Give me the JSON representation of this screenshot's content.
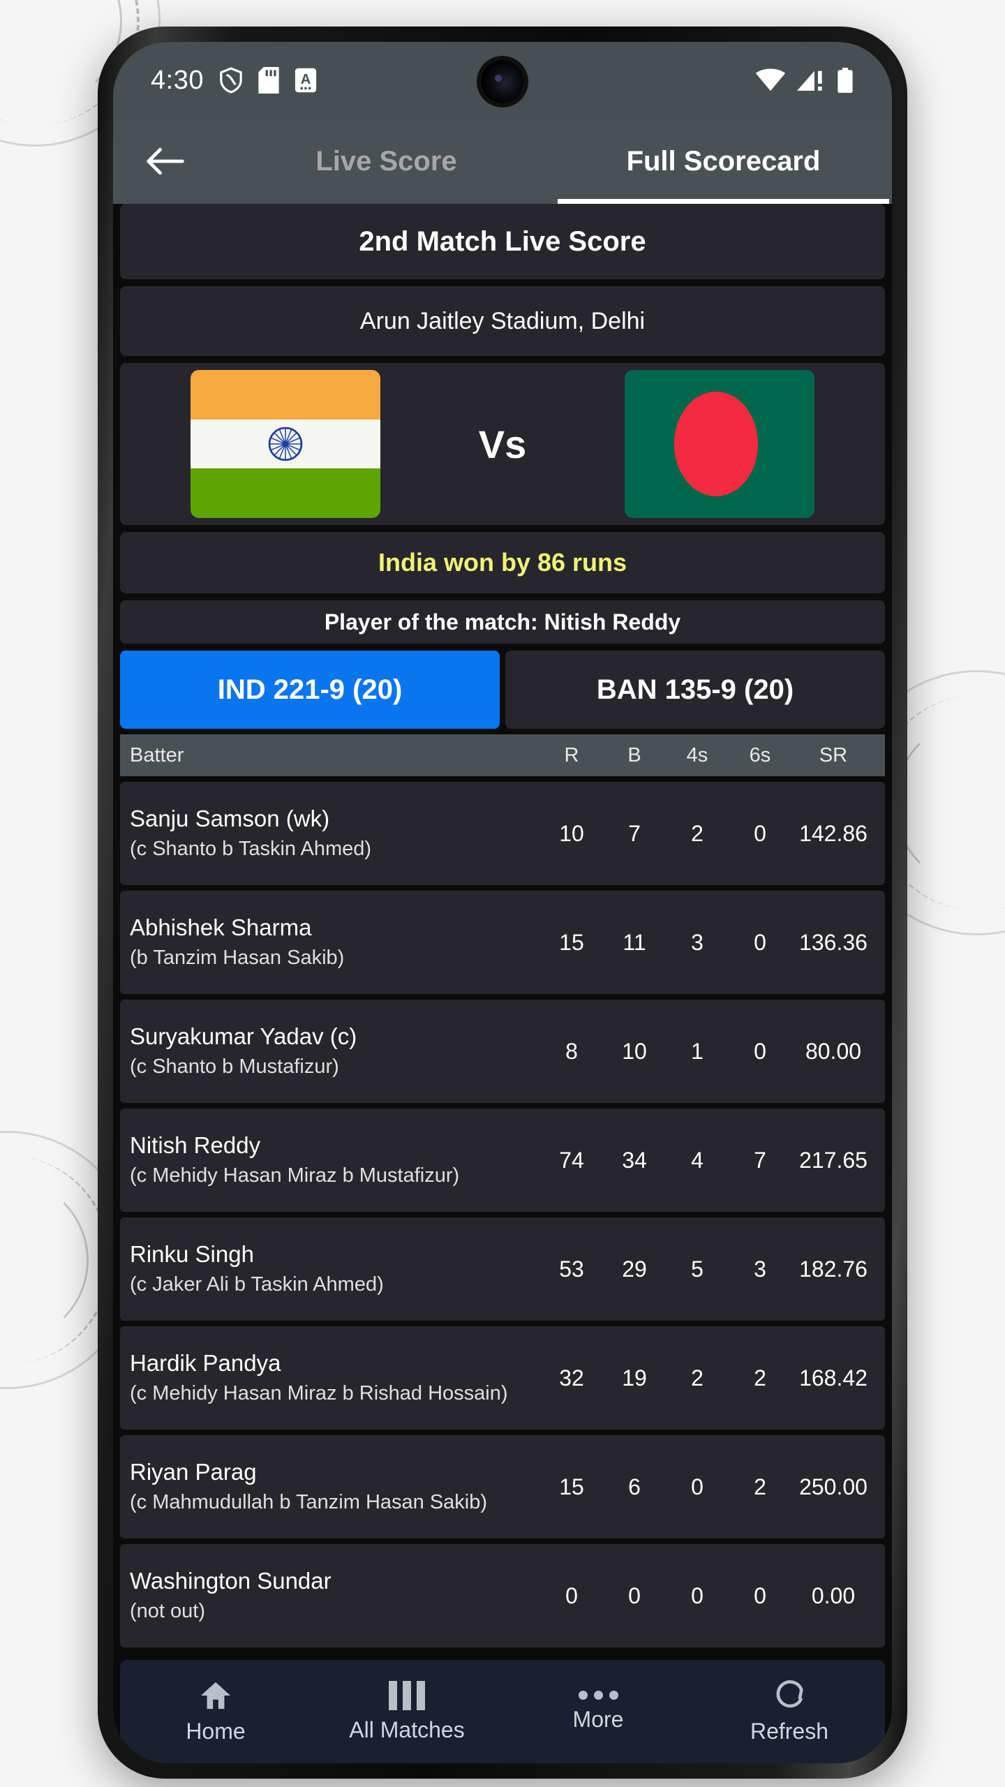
{
  "status_bar": {
    "time": "4:30",
    "left_icons": [
      "shield-icon",
      "sd-card-icon",
      "alphabet-mode-icon"
    ],
    "right_icons": [
      "wifi-icon",
      "cellular-signal-warning-icon",
      "battery-icon"
    ]
  },
  "app_bar": {
    "back_icon": "back-arrow-icon",
    "tabs": [
      {
        "label": "Live Score",
        "active": false
      },
      {
        "label": "Full Scorecard",
        "active": true
      }
    ]
  },
  "match": {
    "title": "2nd Match Live Score",
    "venue": "Arun Jaitley Stadium, Delhi",
    "vs_label": "Vs",
    "team_home": "India",
    "team_away": "Bangladesh",
    "result": "India won by 86 runs",
    "player_of_the_match": "Player of the match: Nitish Reddy"
  },
  "innings_tabs": [
    {
      "label": "IND 221-9 (20)",
      "active": true
    },
    {
      "label": "BAN 135-9 (20)",
      "active": false
    }
  ],
  "colors": {
    "accent_blue": "#0A76ED",
    "result_yellow": "#F1F178",
    "card_bg": "#26262C",
    "header_gray": "#4A5154",
    "nav_bg": "#1A2030",
    "india_saffron": "#F6A93E",
    "india_white": "#F5F5F2",
    "india_green": "#5DA502",
    "india_chakra": "#1A3FA0",
    "bangladesh_green": "#00684A",
    "bangladesh_red": "#F42A41"
  },
  "scorecard": {
    "columns": [
      "Batter",
      "R",
      "B",
      "4s",
      "6s",
      "SR"
    ],
    "rows": [
      {
        "name": "Sanju Samson (wk)",
        "dismissal": "(c Shanto b Taskin Ahmed)",
        "r": "10",
        "b": "7",
        "fours": "2",
        "sixes": "0",
        "sr": "142.86"
      },
      {
        "name": "Abhishek Sharma",
        "dismissal": "(b Tanzim Hasan Sakib)",
        "r": "15",
        "b": "11",
        "fours": "3",
        "sixes": "0",
        "sr": "136.36"
      },
      {
        "name": "Suryakumar Yadav (c)",
        "dismissal": "(c Shanto b Mustafizur)",
        "r": "8",
        "b": "10",
        "fours": "1",
        "sixes": "0",
        "sr": "80.00"
      },
      {
        "name": "Nitish Reddy",
        "dismissal": "(c Mehidy Hasan Miraz b Mustafizur)",
        "r": "74",
        "b": "34",
        "fours": "4",
        "sixes": "7",
        "sr": "217.65"
      },
      {
        "name": "Rinku Singh",
        "dismissal": "(c Jaker Ali b Taskin Ahmed)",
        "r": "53",
        "b": "29",
        "fours": "5",
        "sixes": "3",
        "sr": "182.76"
      },
      {
        "name": "Hardik Pandya",
        "dismissal": "(c Mehidy Hasan Miraz b Rishad Hossain)",
        "r": "32",
        "b": "19",
        "fours": "2",
        "sixes": "2",
        "sr": "168.42"
      },
      {
        "name": "Riyan Parag",
        "dismissal": "(c Mahmudullah b Tanzim Hasan Sakib)",
        "r": "15",
        "b": "6",
        "fours": "0",
        "sixes": "2",
        "sr": "250.00"
      },
      {
        "name": "Washington Sundar",
        "dismissal": "(not out)",
        "r": "0",
        "b": "0",
        "fours": "0",
        "sixes": "0",
        "sr": "0.00"
      }
    ]
  },
  "bottom_nav": [
    {
      "label": "Home",
      "icon": "home-icon"
    },
    {
      "label": "All Matches",
      "icon": "columns-icon"
    },
    {
      "label": "More",
      "icon": "more-dots-icon"
    },
    {
      "label": "Refresh",
      "icon": "refresh-icon"
    }
  ]
}
